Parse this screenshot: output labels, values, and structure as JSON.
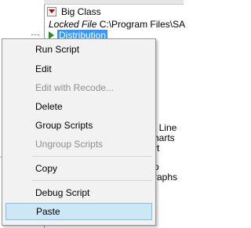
{
  "table": {
    "title": "Big Class",
    "locked_label": "Locked File",
    "locked_path": "C:\\Program Files\\SA",
    "script_name": "Distribution"
  },
  "background_items": [
    "t Line",
    "harts",
    "rt",
    "o",
    "raphs"
  ],
  "menu": {
    "items": [
      {
        "label": "Run Script",
        "enabled": true
      },
      {
        "label": "Edit",
        "enabled": true
      },
      {
        "label": "Edit with Recode...",
        "enabled": false
      },
      {
        "label": "Delete",
        "enabled": true
      },
      {
        "label": "Group Scripts",
        "enabled": true
      },
      {
        "label": "Ungroup Scripts",
        "enabled": false
      },
      {
        "label": "Copy",
        "enabled": true
      },
      {
        "label": "Debug Script",
        "enabled": true
      },
      {
        "label": "Paste",
        "enabled": true,
        "highlighted": true
      }
    ]
  },
  "colors": {
    "menu_bg": "#f2f2f2",
    "highlight_bg": "#cce8f7",
    "highlight_border": "#7fbfe0",
    "selection_bg": "#3399ff",
    "play_icon": "#2a8a2a",
    "dropdown_icon": "#c00000"
  }
}
